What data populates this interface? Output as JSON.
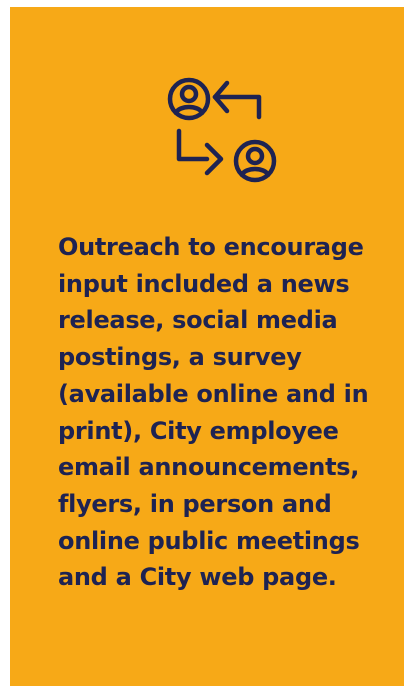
{
  "colors": {
    "panel_background": "#F7A917",
    "text": "#1E2352",
    "icon_stroke": "#1E2352"
  },
  "icon": {
    "name": "user-exchange-icon"
  },
  "message": "Outreach to encourage\ninput included a news\nrelease, social media\npostings, a survey\n(available online and in\nprint), City employee\nemail announcements,\nflyers, in person and\nonline public meetings\nand a City web page."
}
